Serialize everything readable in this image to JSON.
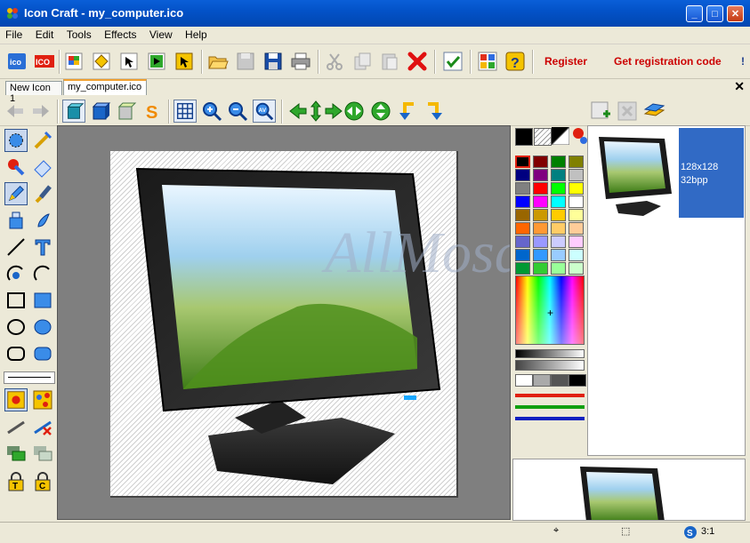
{
  "window": {
    "title": "Icon Craft - my_computer.ico"
  },
  "menu": [
    "File",
    "Edit",
    "Tools",
    "Effects",
    "View",
    "Help"
  ],
  "toolbar": {
    "register_label": "Register",
    "get_code_label": "Get registration code",
    "more_label": "!"
  },
  "tabs": [
    {
      "label": "New Icon 1",
      "active": false
    },
    {
      "label": "my_computer.ico",
      "active": true
    }
  ],
  "canvas": {
    "watermark": "AllMosq"
  },
  "formats": [
    {
      "size": "128x128",
      "depth": "32bpp",
      "selected": true
    }
  ],
  "status": {
    "zoom": "3:1"
  },
  "colors": {
    "accent": "#316ac5",
    "register": "#cc0000",
    "palette": [
      "#000000",
      "#800000",
      "#008000",
      "#808000",
      "#000080",
      "#800080",
      "#008080",
      "#c0c0c0",
      "#808080",
      "#ff0000",
      "#00ff00",
      "#ffff00",
      "#0000ff",
      "#ff00ff",
      "#00ffff",
      "#ffffff",
      "#996600",
      "#cc9900",
      "#ffcc00",
      "#ffff99",
      "#ff6600",
      "#ff9933",
      "#ffcc66",
      "#ffcc99",
      "#6666cc",
      "#9999ff",
      "#ccccff",
      "#ffccff",
      "#0066cc",
      "#3399ff",
      "#99ccff",
      "#ccffff",
      "#009933",
      "#33cc33",
      "#99ff99",
      "#ccffcc"
    ]
  }
}
